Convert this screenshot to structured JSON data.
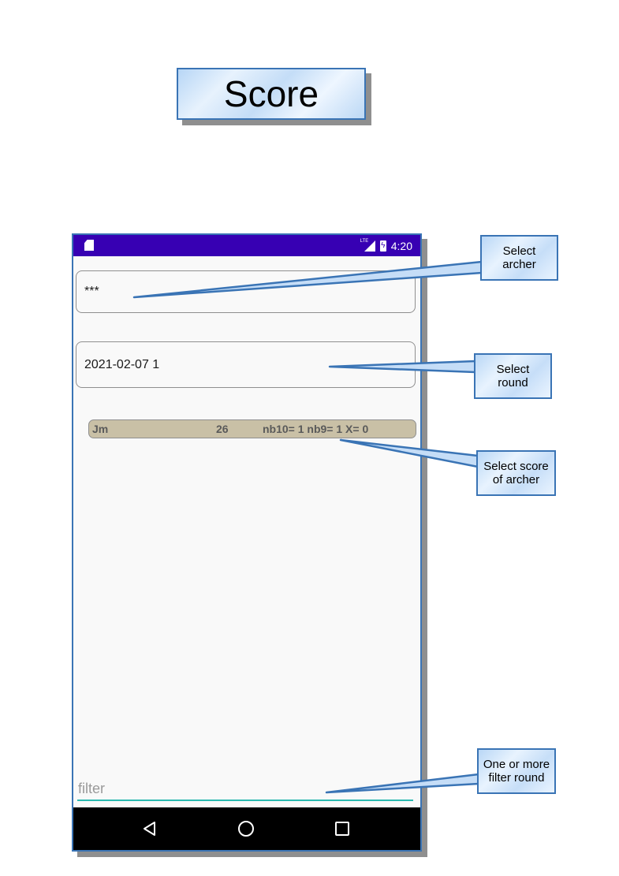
{
  "title": "Score",
  "status_bar": {
    "time": "4:20",
    "network": "LTE"
  },
  "archer_field": {
    "value": "***"
  },
  "round_field": {
    "value": "2021-02-07 1"
  },
  "score_row": {
    "name": "Jm",
    "score": "26",
    "details": "nb10= 1 nb9= 1 X= 0"
  },
  "filter": {
    "placeholder": "filter",
    "value": ""
  },
  "nav": {
    "back": "back-icon",
    "home": "home-icon",
    "recents": "recents-icon"
  },
  "callouts": {
    "archer": [
      "Select",
      "archer"
    ],
    "round": [
      "Select",
      "round"
    ],
    "score": [
      "Select score",
      "of archer"
    ],
    "filter": [
      "One or more",
      "filter round"
    ]
  },
  "colors": {
    "status_bar": "#3700b3",
    "score_row": "#c9c0a6",
    "filter_underline": "#2bb9b0",
    "callout_border": "#3a74b5"
  }
}
